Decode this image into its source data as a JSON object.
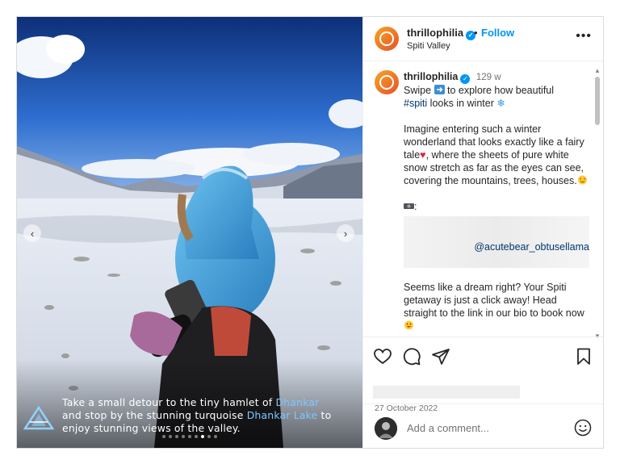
{
  "post": {
    "username": "thrillophilia",
    "follow_label": "Follow",
    "separator": "•",
    "location": "Spiti Valley",
    "more_label": "•••"
  },
  "media": {
    "caption_line1_a": "Take a small detour to the tiny hamlet of ",
    "caption_line1_b": "Dhankar",
    "caption_line2_a": "and stop by the stunning turquoise ",
    "caption_line2_b": "Dhankar Lake",
    "caption_line2_c": " to",
    "caption_line3": "enjoy stunning views of the valley.",
    "dot_count": 9,
    "active_dot": 7
  },
  "comment": {
    "username": "thrillophilia",
    "time": "129 w",
    "p1_a": "Swipe ",
    "p1_b": " to explore how beautiful",
    "p1_tag": "#spiti",
    "p1_c": " looks in winter ",
    "p2_a": "Imagine entering such a winter wonderland that looks exactly like a fairy tale",
    "p2_b": ", where the sheets of pure white snow stretch as far as the eyes can see, covering the mountains, trees, houses.",
    "p3_prefix": ":",
    "p3_mention": "@acutebear_obtusellama",
    "p4": "Seems like a dream right? Your Spiti getaway is just a click away! Head straight to the link in our bio to book now"
  },
  "footer": {
    "date": "27 October 2022",
    "comment_placeholder": "Add a comment..."
  },
  "colors": {
    "accent": "#0095f6",
    "link": "#00376b",
    "caption_highlight": "#7fc7ff"
  },
  "icons": [
    "heart-icon",
    "comment-icon",
    "share-icon",
    "bookmark-icon",
    "smiley-icon",
    "more-icon",
    "verified-icon"
  ]
}
